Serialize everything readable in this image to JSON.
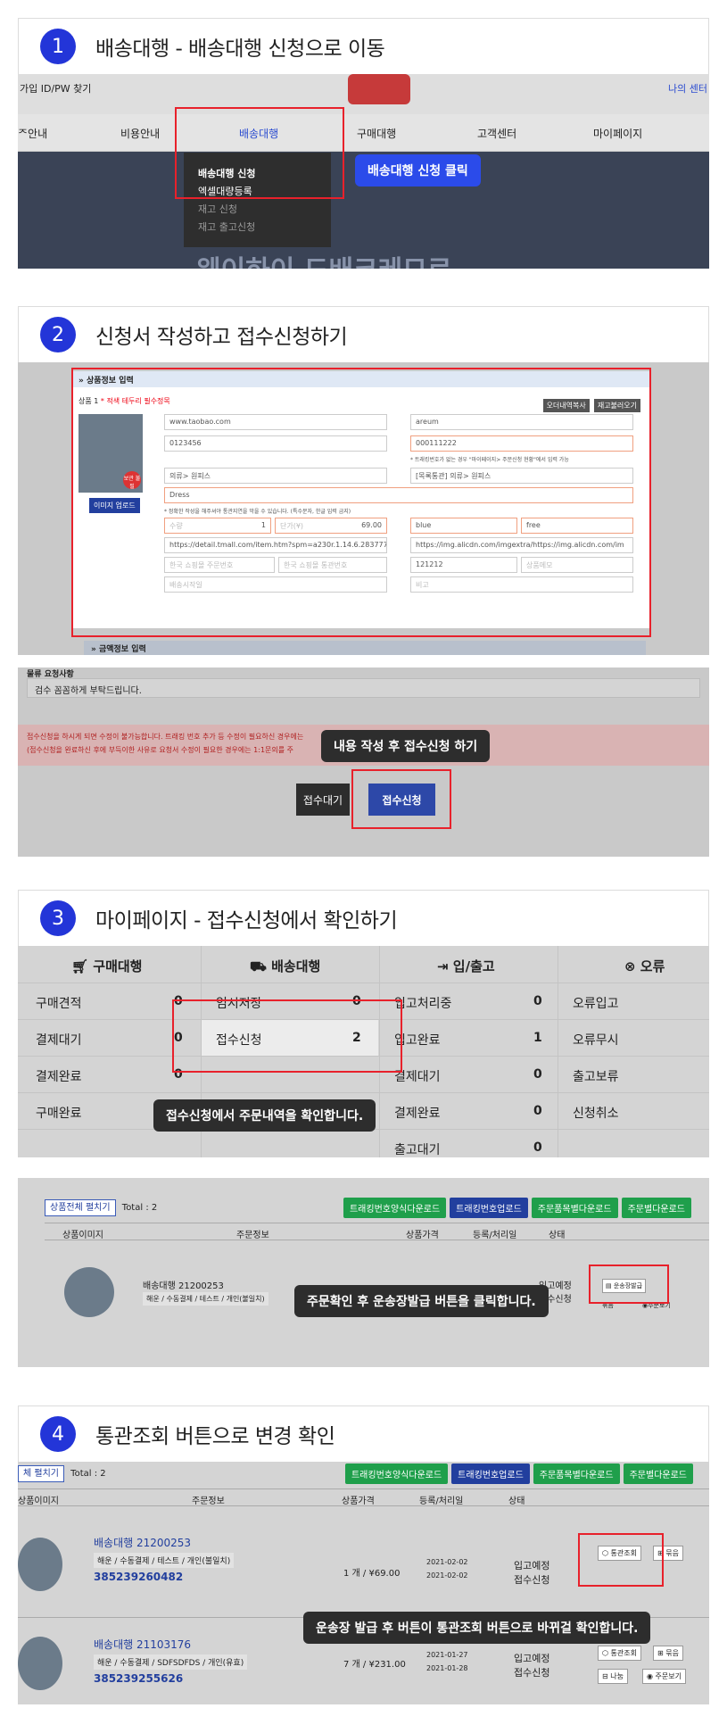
{
  "sections": [
    {
      "num": "1",
      "title": "배송대행 - 배송대행 신청으로 이동"
    },
    {
      "num": "2",
      "title": "신청서 작성하고 접수신청하기"
    },
    {
      "num": "3",
      "title": "마이페이지 - 접수신청에서 확인하기"
    },
    {
      "num": "4",
      "title": "통관조회 버튼으로 변경 확인"
    }
  ],
  "s1": {
    "top_left": "가입 ID/PW 찾기",
    "top_right": "나의 센터",
    "nav": [
      "ᄌ안내",
      "비용안내",
      "배송대행",
      "구매대행",
      "고객센터",
      "마이페이지"
    ],
    "dropdown": [
      "배송대행 신청",
      "엑셀대량등록",
      "재고 신청",
      "재고 출고신청"
    ],
    "tip": "배송대행 신청 클릭",
    "banner": "웨이하이 드배크레므로"
  },
  "s2": {
    "panel_title": "상품정보 입력",
    "item_label": "상품 1",
    "item_req": "* 적색 테두리 필수정목",
    "btn_copy": "오더내역복사",
    "btn_load": "재고불러오기",
    "site": "www.taobao.com",
    "name": "areum",
    "order": "0123456",
    "track": "000111222",
    "track_note": "* 트래킹번호가 없는 경우 \"마이페이지> 주문신청 현황\"에서 입력 가능",
    "cat1": "의류> 원피스",
    "cat2": "[목록통관] 의류> 원피스",
    "desc": "Dress",
    "note": "* 정확한 작성을 해주셔야 통관지연을 막을 수 있습니다. (특수문자, 한글 입력 금지)",
    "qty_ph": "수량",
    "qty": "1",
    "price_ph": "단가(¥)",
    "price": "69.00",
    "color": "blue",
    "size": "free",
    "url1": "https://detail.tmall.com/item.htm?spm=a230r.1.14.6.283777",
    "url2": "https://img.alicdn.com/imgextra/https://img.alicdn.com/im",
    "ph1": "한국 쇼핑몰 주문번호",
    "ph2": "한국 쇼핑몰 통관번호",
    "code": "121212",
    "ph3": "상품메모",
    "ph4": "배송시작일",
    "ph5": "비고",
    "upload": "이미지 업로드",
    "thumb_badge": "보관 불필",
    "panel2_title": "금액정보 입력",
    "req_label": "물류 요청사항",
    "req_text": "검수 꼼꼼하게 부탁드립니다.",
    "warn1": "접수신청을 하시게 되면 수정이 불가능합니다. 트래킹 번호 추가 등 수정이 필요하신 경우에는",
    "warn2": "(접수신청을 완료하신 후에 부득이한 사유로 요청서 수정이 필요한 경우에는 1:1문의를 주",
    "tip": "내용 작성 후 접수신청 하기",
    "btn_save": "접수대기",
    "btn_submit": "접수신청"
  },
  "s3": {
    "headers": [
      "구매대행",
      "배송대행",
      "입/출고",
      "오류"
    ],
    "col1": [
      [
        "구매견적",
        "0"
      ],
      [
        "결제대기",
        "0"
      ],
      [
        "결제완료",
        "0"
      ],
      [
        "구매완료",
        ""
      ]
    ],
    "col2": [
      [
        "임시저장",
        "0"
      ],
      [
        "접수신청",
        "2"
      ]
    ],
    "col3": [
      [
        "입고처리중",
        "0"
      ],
      [
        "입고완료",
        "1"
      ],
      [
        "결제대기",
        "0"
      ],
      [
        "결제완료",
        "0"
      ],
      [
        "출고대기",
        "0"
      ]
    ],
    "col4": [
      "오류입고",
      "오류무시",
      "출고보류",
      "신청취소"
    ],
    "tip1": "접수신청에서 주문내역을 확인합니다.",
    "expand": "상품전체 펼치기",
    "total": "Total : 2",
    "dl": [
      "트래킹번호양식다운로드",
      "트래킹번호업로드",
      "주문품목별다운로드",
      "주문별다운로드"
    ],
    "th": [
      "상품이미지",
      "주문정보",
      "상품가격",
      "등록/처리일",
      "상태"
    ],
    "order": "배송대행 21200253",
    "order_sub": "해운 / 수동결제 / 테스트 / 개인(불일치)",
    "tip2": "주문확인 후 운송장발급 버튼을 클릭합니다.",
    "btn_issue": "운송장발급",
    "btn_bundle": "묶음",
    "btn_view": "주문보기",
    "status": [
      "입고예정",
      "접수신청"
    ]
  },
  "s4": {
    "expand": "체 펼치기",
    "total": "Total : 2",
    "th": [
      "상품이미지",
      "주문정보",
      "상품가격",
      "등록/처리일",
      "상태"
    ],
    "rows": [
      {
        "order": "배송대행 21200253",
        "sub": "해운 / 수동결제 / 테스트 / 개인(불일치)",
        "track": "385239260482",
        "price": "1 개 / ¥69.00",
        "d1": "2021-02-02",
        "d2": "2021-02-02",
        "s1": "입고예정",
        "s2": "접수신청"
      },
      {
        "order": "배송대행 21103176",
        "sub": "해운 / 수동결제 / SDFSDFDS / 개인(유효)",
        "track": "385239255626",
        "price": "7 개 / ¥231.00",
        "d1": "2021-01-27",
        "d2": "2021-01-28",
        "s1": "입고예정",
        "s2": "접수신청"
      }
    ],
    "btn_customs": "통관조회",
    "btn_bundle": "묶음",
    "btn_split": "나눔",
    "btn_view": "주문보기",
    "tip": "운송장 발급 후 버튼이 통관조회 버튼으로 바뀌걸 확인합니다."
  },
  "colors": {
    "accent": "#2335d8",
    "highlight": "#e8212b",
    "download": "#1f9f4b",
    "upload": "#223f9e"
  }
}
